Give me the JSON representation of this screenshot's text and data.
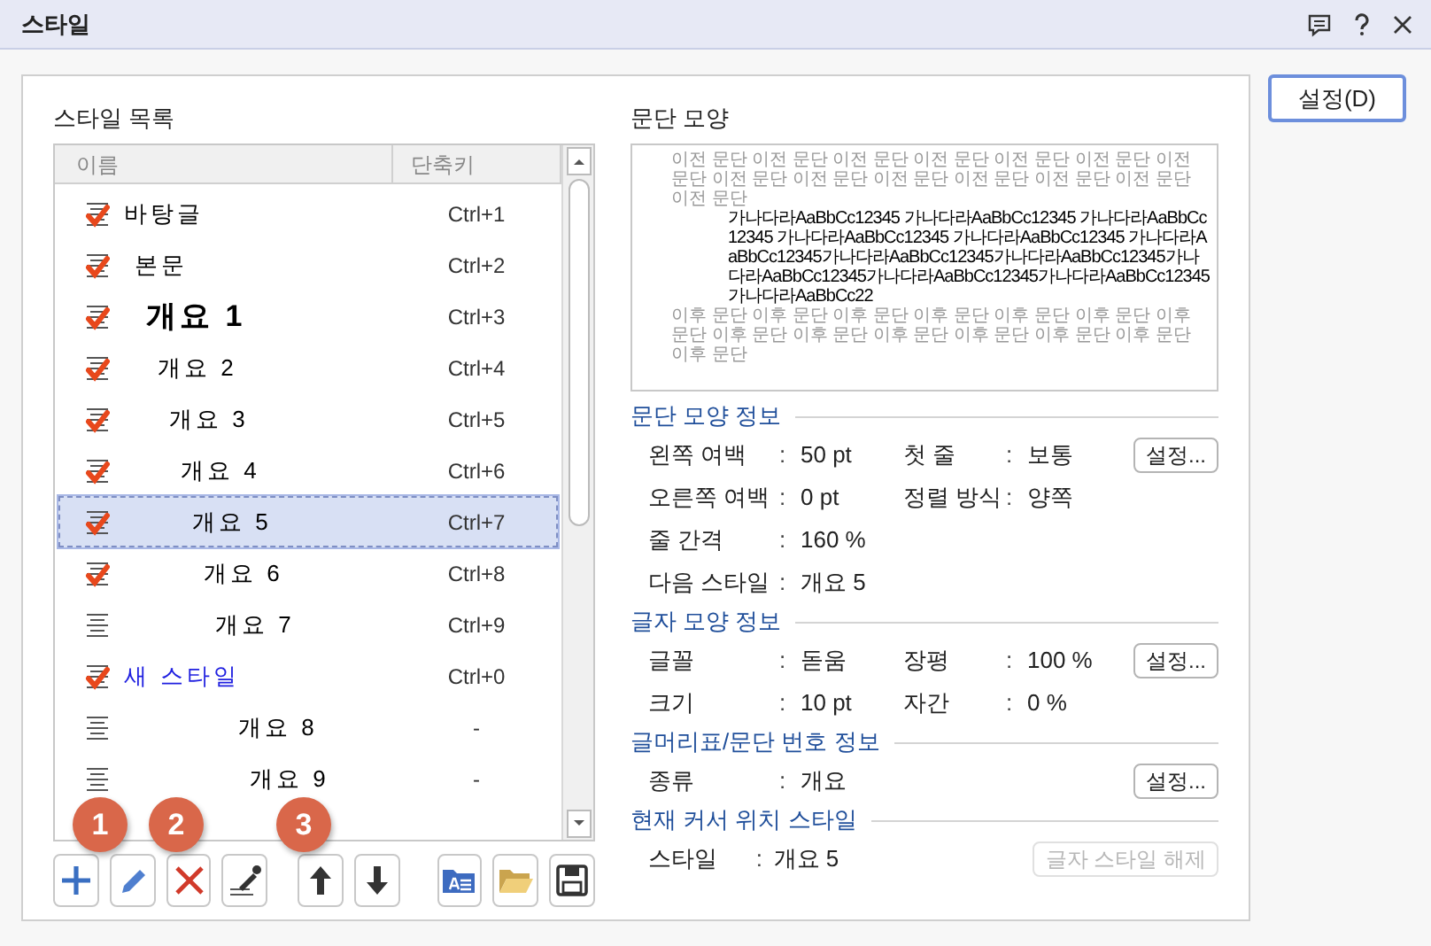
{
  "window": {
    "title": "스타일"
  },
  "list_title": "스타일 목록",
  "columns": [
    "이름",
    "단축키"
  ],
  "styles": [
    {
      "name": "바탕글",
      "shortcut": "Ctrl+1",
      "applied": true,
      "kind": "base",
      "selected": false
    },
    {
      "name": "본문",
      "shortcut": "Ctrl+2",
      "applied": true,
      "kind": "paragraph",
      "selected": false
    },
    {
      "name": "개요 1",
      "shortcut": "Ctrl+3",
      "applied": true,
      "kind": "heading",
      "selected": false
    },
    {
      "name": "개요 2",
      "shortcut": "Ctrl+4",
      "applied": true,
      "kind": "paragraph",
      "selected": false
    },
    {
      "name": "개요 3",
      "shortcut": "Ctrl+5",
      "applied": true,
      "kind": "paragraph",
      "selected": false
    },
    {
      "name": "개요 4",
      "shortcut": "Ctrl+6",
      "applied": true,
      "kind": "paragraph",
      "selected": false
    },
    {
      "name": "개요 5",
      "shortcut": "Ctrl+7",
      "applied": true,
      "kind": "paragraph",
      "selected": true
    },
    {
      "name": "개요 6",
      "shortcut": "Ctrl+8",
      "applied": true,
      "kind": "paragraph",
      "selected": false
    },
    {
      "name": "개요 7",
      "shortcut": "Ctrl+9",
      "applied": false,
      "kind": "paragraph",
      "selected": false
    },
    {
      "name": "새 스타일",
      "shortcut": "Ctrl+0",
      "applied": true,
      "kind": "custom",
      "selected": false
    },
    {
      "name": "개요 8",
      "shortcut": "-",
      "applied": false,
      "kind": "paragraph",
      "selected": false
    },
    {
      "name": "개요 9",
      "shortcut": "-",
      "applied": false,
      "kind": "paragraph",
      "selected": false
    }
  ],
  "callouts": [
    "1",
    "2",
    "3"
  ],
  "preview": {
    "title": "문단 모양",
    "before": "이전 문단 이전 문단 이전 문단 이전 문단 이전 문단 이전 문단 이전 문단 이전 문단 이전 문단 이전 문단 이전 문단 이전 문단 이전 문단 이전 문단",
    "sample": "가나다라AaBbCc12345 가나다라AaBbCc12345 가나다라AaBbCc12345 가나다라AaBbCc12345 가나다라AaBbCc12345 가나다라AaBbCc12345가나다라AaBbCc12345가나다라AaBbCc12345가나다라AaBbCc12345가나다라AaBbCc12345가나다라AaBbCc12345가나다라AaBbCc22",
    "after": "이후 문단 이후 문단 이후 문단 이후 문단 이후 문단 이후 문단 이후 문단 이후 문단 이후 문단 이후 문단 이후 문단 이후 문단 이후 문단 이후 문단"
  },
  "sections": [
    {
      "title": "문단 모양 정보",
      "rows": [
        {
          "label": "왼쪽 여백",
          "value": "50 pt",
          "label2": "첫 줄",
          "value2": "보통",
          "button": "설정...",
          "disabled": false
        },
        {
          "label": "오른쪽 여백",
          "value": "0 pt",
          "label2": "정렬 방식",
          "value2": "양쪽"
        },
        {
          "label": "줄 간격",
          "value": "160 %"
        },
        {
          "label": "다음 스타일",
          "value": "개요 5"
        }
      ]
    },
    {
      "title": "글자 모양 정보",
      "rows": [
        {
          "label": "글꼴",
          "value": "돋움",
          "label2": "장평",
          "value2": "100 %",
          "button": "설정...",
          "disabled": false
        },
        {
          "label": "크기",
          "value": "10 pt",
          "label2": "자간",
          "value2": "0 %"
        }
      ]
    },
    {
      "title": "글머리표/문단 번호 정보",
      "rows": [
        {
          "label": "종류",
          "value": "개요",
          "button": "설정...",
          "disabled": false
        }
      ]
    },
    {
      "title": "현재 커서 위치 스타일",
      "rows": [
        {
          "label": "스타일",
          "value": "개요 5",
          "button": "글자 스타일 해제",
          "disabled": true
        }
      ]
    }
  ],
  "colon": ":",
  "setup_button": "설정(D)"
}
